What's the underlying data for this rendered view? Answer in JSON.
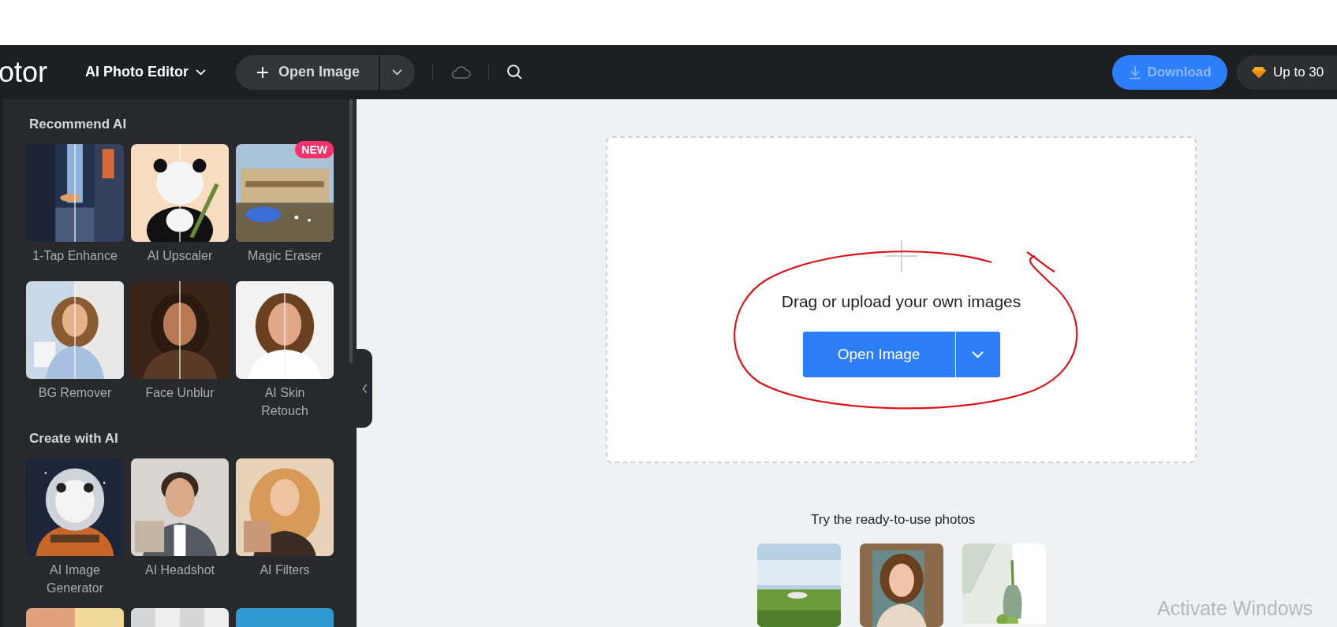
{
  "header": {
    "logo": "otor",
    "editor_menu": "AI Photo Editor",
    "open_image": "Open Image",
    "download": "Download",
    "promo": "Up to 30"
  },
  "sidebar": {
    "sections": [
      {
        "title": "Recommend AI",
        "tools": [
          {
            "kind": "tool",
            "label": "1-Tap Enhance"
          },
          {
            "kind": "tool",
            "label": "AI Upscaler"
          },
          {
            "kind": "tool",
            "label": "Magic Eraser",
            "badge": "NEW"
          },
          {
            "kind": "tool",
            "label": "BG Remover"
          },
          {
            "kind": "tool",
            "label": "Face Unblur"
          },
          {
            "kind": "tool",
            "label": "AI Skin Retouch"
          }
        ]
      },
      {
        "title": "Create with AI",
        "tools": [
          {
            "kind": "tool",
            "label": "AI Image Generator"
          },
          {
            "kind": "tool",
            "label": "AI Headshot"
          },
          {
            "kind": "tool",
            "label": "AI Filters"
          },
          {
            "kind": "picture"
          },
          {
            "kind": "picture"
          },
          {
            "kind": "picture"
          }
        ]
      }
    ]
  },
  "upload": {
    "prompt": "Drag or upload your own images",
    "button": "Open Image"
  },
  "samples": {
    "title": "Try the ready-to-use photos",
    "photos": [
      {
        "kind": "picture"
      },
      {
        "kind": "picture"
      },
      {
        "kind": "picture"
      }
    ]
  },
  "os_overlay": {
    "text": "Activate Windows"
  }
}
